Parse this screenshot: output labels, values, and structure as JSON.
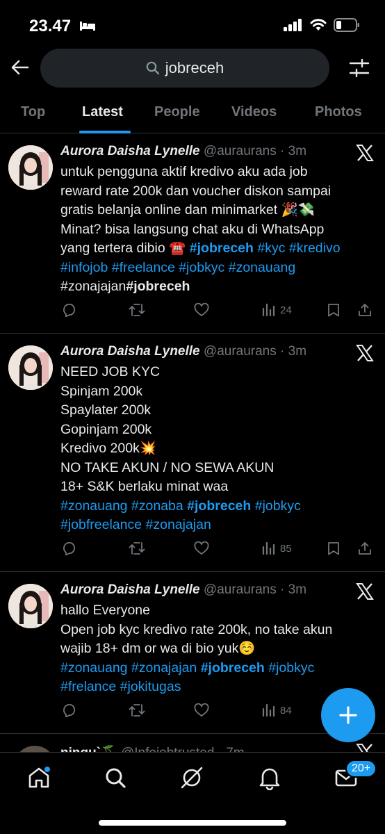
{
  "status": {
    "time": "23.47"
  },
  "search": {
    "query": "jobreceh"
  },
  "tabs": [
    {
      "label": "Top"
    },
    {
      "label": "Latest"
    },
    {
      "label": "People"
    },
    {
      "label": "Videos"
    },
    {
      "label": "Photos"
    }
  ],
  "tweets": [
    {
      "name": "Aurora Daisha Lynelle",
      "handle": "@auraurans",
      "time": "· 3m",
      "views": "24",
      "lines": [
        "untuk pengguna aktif kredivo aku ada job",
        "reward rate 200k dan voucher diskon sampai",
        "gratis belanja online dan minimarket 🎉💸",
        "Minat? bisa langsung chat aku di WhatsApp",
        "yang tertera dibio ☎️",
        "#infojob #freelance #jobkyc #zonauang",
        "#zonajajan",
        "#jobreceh"
      ],
      "line5_tags": [
        "#jobreceh",
        "#kyc",
        "#kredivo"
      ]
    },
    {
      "name": "Aurora Daisha Lynelle",
      "handle": "@auraurans",
      "time": "· 3m",
      "views": "85",
      "lines": [
        "NEED JOB KYC",
        "Spinjam 200k",
        "Spaylater 200k",
        "Gopinjam 200k",
        "Kredivo 200k💥",
        "NO TAKE AKUN / NO SEWA AKUN",
        "18+ S&K berlaku minat waa",
        "#zonauang #zonaba",
        "#jobreceh",
        "#jobkyc",
        "#jobfreelance #zonajajan"
      ]
    },
    {
      "name": "Aurora Daisha Lynelle",
      "handle": "@auraurans",
      "time": "· 3m",
      "views": "84",
      "lines": [
        "hallo Everyone",
        "Open job kyc kredivo rate 200k, no take akun",
        "wajib 18+ dm or wa di bio yuk☺️",
        "#zonauang #zonajajan",
        "#jobreceh",
        "#jobkyc",
        "#frelance #jokitugas"
      ]
    }
  ],
  "partial_tweet": {
    "name": "ningu`🍒",
    "handle": "@Infojobtrusted",
    "time": "· 7m"
  },
  "nav": {
    "badge": "20+"
  },
  "colors": {
    "accent": "#1d9bf0",
    "bg": "#000000",
    "muted": "#71767b",
    "text": "#e7e9ea",
    "divider": "#2f3336"
  }
}
